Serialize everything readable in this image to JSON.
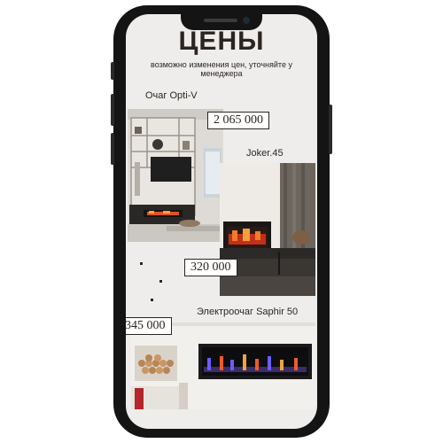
{
  "page": {
    "title": "ЦЕНЫ",
    "subtitle": "возможно изменения цен, уточняйте у менеджера"
  },
  "products": [
    {
      "name": "Очаг Opti-V",
      "price": "2 065 000"
    },
    {
      "name": "Joker.45",
      "price": "320 000"
    },
    {
      "name": "Электроочаг Saphir 50",
      "price": "345 000"
    }
  ],
  "colors": {
    "phone_frame": "#141414",
    "screen_bg": "#efedec",
    "text": "#2b2521",
    "flame": "#e0502a"
  }
}
